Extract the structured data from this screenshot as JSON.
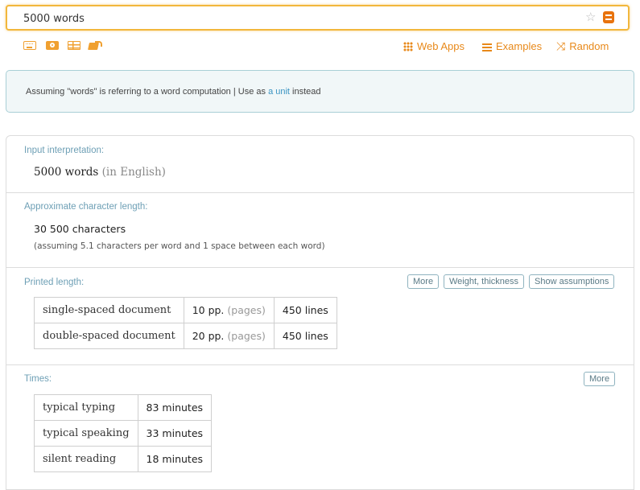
{
  "search": {
    "value": "5000 words"
  },
  "nav": {
    "web_apps": "Web Apps",
    "examples": "Examples",
    "random": "Random"
  },
  "assumption": {
    "prefix": "Assuming \"words\" is referring to a word computation | Use as ",
    "link": "a unit",
    "suffix": " instead"
  },
  "pods": {
    "input": {
      "title": "Input interpretation:",
      "main": "5000 words",
      "qualifier": "(in English)"
    },
    "chars": {
      "title": "Approximate character length:",
      "value": "30 500 characters",
      "note": "(assuming 5.1 characters per word and 1 space between each word)"
    },
    "printed": {
      "title": "Printed length:",
      "buttons": [
        "More",
        "Weight, thickness",
        "Show assumptions"
      ],
      "rows": [
        {
          "label": "single-spaced document",
          "pages": "10 pp.",
          "unit": "(pages)",
          "lines": "450 lines"
        },
        {
          "label": "double-spaced document",
          "pages": "20 pp.",
          "unit": "(pages)",
          "lines": "450 lines"
        }
      ]
    },
    "times": {
      "title": "Times:",
      "button": "More",
      "rows": [
        {
          "label": "typical typing",
          "value": "83 minutes"
        },
        {
          "label": "typical speaking",
          "value": "33 minutes"
        },
        {
          "label": "silent reading",
          "value": "18 minutes"
        }
      ]
    }
  },
  "colors": {
    "accent": "#e8891a",
    "search_border": "#f2b73c",
    "pod_title": "#6d9fb5",
    "link": "#3a94c2"
  }
}
